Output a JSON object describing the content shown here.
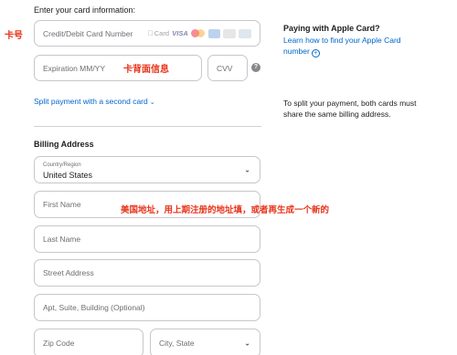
{
  "card_section": {
    "intro": "Enter your card information:",
    "card_number_placeholder": "Credit/Debit Card Number",
    "apple_card_badge": "Card",
    "visa_badge": "VISA",
    "expiration_placeholder": "Expiration MM/YY",
    "cvv_placeholder": "CVV",
    "info_icon": "?",
    "split_link": "Split payment with a second card",
    "split_chevron": "⌄"
  },
  "billing": {
    "title": "Billing Address",
    "country_label": "Country/Region",
    "country_value": "United States",
    "first_name_placeholder": "First Name",
    "last_name_placeholder": "Last Name",
    "street_placeholder": "Street Address",
    "apt_placeholder": "Apt, Suite, Building (Optional)",
    "zip_placeholder": "Zip Code",
    "city_state_placeholder": "City, State"
  },
  "sidebar": {
    "apple_card_title": "Paying with Apple Card?",
    "apple_card_link": "Learn how to find your Apple Card number",
    "split_note": "To split your payment, both cards must share the same billing address."
  },
  "annotations": {
    "card_number": "卡号",
    "card_back_info": "卡背面信息",
    "address_hint": "美国地址，用上期注册的地址填，或者再生成一个新的"
  },
  "colors": {
    "link": "#0066cc",
    "annotation": "#e8351b",
    "border": "#c7c7cc"
  },
  "icons": [
    "apple-card-logo-icon",
    "visa-logo-icon",
    "mastercard-logo-icon",
    "amex-logo-icon",
    "discover-logo-icon",
    "jcb-logo-icon",
    "info-icon",
    "chevron-down-icon",
    "plus-circle-icon"
  ]
}
